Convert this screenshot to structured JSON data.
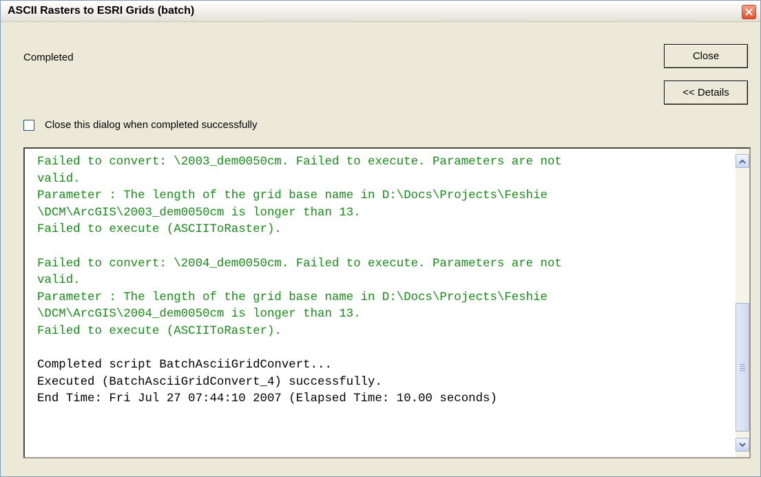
{
  "window": {
    "title": "ASCII Rasters to ESRI Grids (batch)"
  },
  "status": {
    "text": "Completed"
  },
  "buttons": {
    "close_label": "Close",
    "details_label": "<< Details"
  },
  "checkbox": {
    "label": "Close this dialog when completed successfully",
    "checked": false
  },
  "log": {
    "lines": [
      {
        "text": "Failed to convert: \\2003_dem0050cm. Failed to execute. Parameters are not",
        "color": "green"
      },
      {
        "text": "valid.",
        "color": "green"
      },
      {
        "text": "Parameter : The length of the grid base name in D:\\Docs\\Projects\\Feshie",
        "color": "green"
      },
      {
        "text": "\\DCM\\ArcGIS\\2003_dem0050cm is longer than 13.",
        "color": "green"
      },
      {
        "text": "Failed to execute (ASCIIToRaster).",
        "color": "green"
      },
      {
        "text": "",
        "color": "black"
      },
      {
        "text": "Failed to convert: \\2004_dem0050cm. Failed to execute. Parameters are not",
        "color": "green"
      },
      {
        "text": "valid.",
        "color": "green"
      },
      {
        "text": "Parameter : The length of the grid base name in D:\\Docs\\Projects\\Feshie",
        "color": "green"
      },
      {
        "text": "\\DCM\\ArcGIS\\2004_dem0050cm is longer than 13.",
        "color": "green"
      },
      {
        "text": "Failed to execute (ASCIIToRaster).",
        "color": "green"
      },
      {
        "text": "",
        "color": "black"
      },
      {
        "text": "Completed script BatchAsciiGridConvert...",
        "color": "black"
      },
      {
        "text": "Executed (BatchAsciiGridConvert_4) successfully.",
        "color": "black"
      },
      {
        "text": "End Time: Fri Jul 27 07:44:10 2007 (Elapsed Time: 10.00 seconds)",
        "color": "black"
      }
    ]
  },
  "icons": {
    "title_close": "close-icon",
    "scroll_up": "chevron-up-icon",
    "scroll_down": "chevron-down-icon",
    "scroll_grip": "grip-icon"
  },
  "colors": {
    "success_text": "#1a8a1a",
    "normal_text": "#000000",
    "title_close": "#e2502b"
  }
}
